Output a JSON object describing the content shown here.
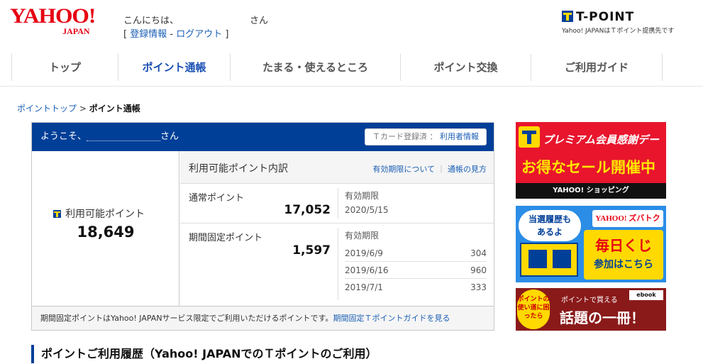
{
  "header": {
    "logo_main": "YAHOO!",
    "logo_sub": "JAPAN",
    "greeting_prefix": "こんにちは、",
    "greeting_suffix": "さん",
    "link_open": "[ ",
    "link_register": "登録情報",
    "link_sep": " - ",
    "link_logout": "ログアウト",
    "link_close": " ]",
    "tpoint_title": "T-POINT",
    "tpoint_sub": "Yahoo! JAPANはＴポイント提携先です"
  },
  "nav": {
    "items": [
      {
        "label": "トップ"
      },
      {
        "label": "ポイント通帳"
      },
      {
        "label": "たまる・使えるところ"
      },
      {
        "label": "ポイント交換"
      },
      {
        "label": "ご利用ガイド"
      }
    ]
  },
  "breadcrumb": {
    "parent": "ポイントトップ",
    "sep": " > ",
    "current": "ポイント通帳"
  },
  "panel": {
    "welcome_prefix": "ようこそ、",
    "welcome_suffix": "さん",
    "tcard_status": "Ｔカード登録済",
    "tcard_sep": " ： ",
    "user_info_link": "利用者情報",
    "available_label": "利用可能ポイント",
    "available_value": "18,649",
    "breakdown_title": "利用可能ポイント内訳",
    "link_expiry": "有効期限について",
    "link_sep": " ｜ ",
    "link_guide": "通帳の見方",
    "normal_label": "通常ポイント",
    "normal_value": "17,052",
    "expiry_label": "有効期限",
    "normal_expiry": "2020/5/15",
    "fixed_label": "期間固定ポイント",
    "fixed_value": "1,597",
    "fixed_expiry_label": "有効期限",
    "fixed_expiries": [
      {
        "date": "2019/6/9",
        "amount": "304"
      },
      {
        "date": "2019/6/16",
        "amount": "960"
      },
      {
        "date": "2019/7/1",
        "amount": "333"
      }
    ],
    "footer_note": "期間固定ポイントはYahoo! JAPANサービス限定でご利用いただけるポイントです。",
    "footer_link": "期間固定Ｔポイントガイドを見る"
  },
  "section": {
    "title": "ポイントご利用履歴（Yahoo! JAPANでのＴポイントのご利用）"
  },
  "banners": {
    "b1_line1": "プレミアム会員感謝デー",
    "b1_line2": "お得なセール開催中",
    "b1_foot": "YAHOO! ショッピング",
    "b2_bubble1": "当選履歴も",
    "b2_bubble2": "あるよ",
    "b2_logo": "YAHOO! ズバトク",
    "b2_main1": "毎日くじ",
    "b2_main2": "参加はこちら",
    "b3_circle": "ポイントの使い道に困ったら",
    "b3_ebook": "ebook",
    "b3_sub": "ポイントで買える",
    "b3_main": "話題の一冊！"
  },
  "colors": {
    "brand_red": "#e60012",
    "brand_blue": "#003f98",
    "link_blue": "#1a5fb4",
    "tpoint_yellow": "#ffd900"
  }
}
